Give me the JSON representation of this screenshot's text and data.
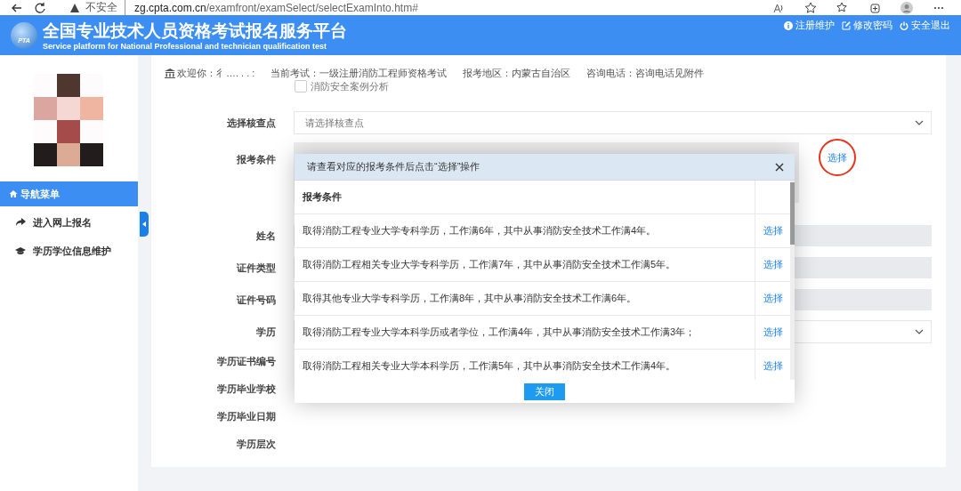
{
  "browser": {
    "security": "不安全",
    "url_host": "zg.cpta.com.cn",
    "url_path": "/examfront/examSelect/selectExamInto.htm#"
  },
  "header": {
    "logo_text": "PTA",
    "title": "全国专业技术人员资格考试报名服务平台",
    "subtitle": "Service platform for National Professional and technician qualification test",
    "links": [
      {
        "label": "注册维护",
        "kind": "info"
      },
      {
        "label": "修改密码",
        "kind": "edit"
      },
      {
        "label": "安全退出",
        "kind": "power"
      }
    ]
  },
  "sidebar": {
    "menu_title": "导航菜单",
    "items": [
      {
        "label": "进入网上报名",
        "kind": "share"
      },
      {
        "label": "学历学位信息维护",
        "kind": "cap"
      }
    ]
  },
  "info_bar": [
    {
      "label": "欢迎你：",
      "value": "彳…. . . :"
    },
    {
      "label": "当前考试：",
      "value": "一级注册消防工程师资格考试"
    },
    {
      "label": "报考地区：",
      "value": "内蒙古自治区"
    },
    {
      "label": "咨询电话：",
      "value": "咨询电话见附件"
    }
  ],
  "form": {
    "option_label": "消防安全案例分析",
    "option_checked": false,
    "fields": [
      {
        "label": "选择核查点",
        "kind": "select",
        "placeholder": "请选择核查点"
      },
      {
        "label": "报考条件",
        "kind": "condition",
        "action": "选择"
      },
      {
        "label": "姓名",
        "kind": "input"
      },
      {
        "label": "证件类型",
        "kind": "input"
      },
      {
        "label": "证件号码",
        "kind": "input"
      },
      {
        "label": "学历",
        "kind": "select"
      },
      {
        "label": "学历证书编号",
        "kind": "none"
      },
      {
        "label": "学历毕业学校",
        "kind": "none"
      },
      {
        "label": "学历毕业日期",
        "kind": "none"
      },
      {
        "label": "学历层次",
        "kind": "none"
      }
    ]
  },
  "modal": {
    "title": "请查看对应的报考条件后点击“选择”操作",
    "column": "报考条件",
    "rows": [
      {
        "text": "取得消防工程专业大学专科学历，工作满6年，其中从事消防安全技术工作满4年。",
        "action": "选择"
      },
      {
        "text": "取得消防工程相关专业大学专科学历，工作满7年，其中从事消防安全技术工作满5年。",
        "action": "选择"
      },
      {
        "text": "取得其他专业大学专科学历，工作满8年，其中从事消防安全技术工作满6年。",
        "action": "选择"
      },
      {
        "text": "取得消防工程专业大学本科学历或者学位，工作满4年，其中从事消防安全技术工作满3年；",
        "action": "选择"
      },
      {
        "text": "取得消防工程相关专业大学本科学历，工作满5年，其中从事消防安全技术工作满4年。",
        "action": "选择"
      }
    ],
    "close_button": "关闭"
  }
}
